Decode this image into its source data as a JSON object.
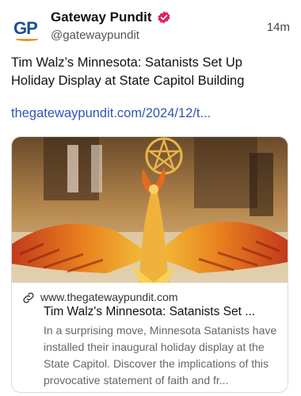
{
  "account": {
    "avatar_text": "GP",
    "name": "Gateway Pundit",
    "handle": "@gatewaypundit",
    "time_ago": "14m",
    "verified_icon": "verified-badge-icon",
    "brand_color": "#1f4e99",
    "verified_color": "#e0245e"
  },
  "post": {
    "text": "Tim Walz’s Minnesota: Satanists Set Up Holiday Display at State Capitol Building",
    "link": "thegatewaypundit.com/2024/12/t..."
  },
  "card": {
    "domain": "www.thegatewaypundit.com",
    "title": "Tim Walz's Minnesota: Satanists Set ...",
    "description": "In a surprising move, Minnesota Satanists have installed their inaugural holiday display at the State Capitol. Discover the implications of this provocative statement of faith and fr...",
    "link_icon": "link-icon"
  }
}
